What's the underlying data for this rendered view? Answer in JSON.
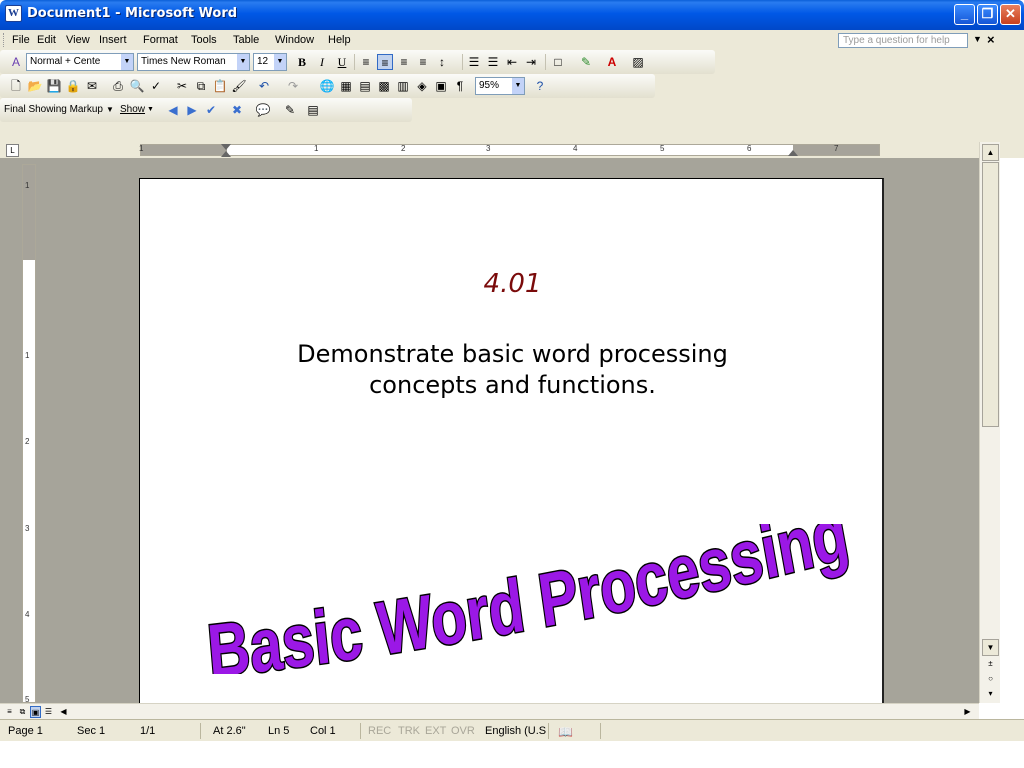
{
  "window": {
    "title": "Document1 - Microsoft Word",
    "icon": "word-app-icon"
  },
  "menu": {
    "items": [
      "File",
      "Edit",
      "View",
      "Insert",
      "Format",
      "Tools",
      "Table",
      "Window",
      "Help"
    ],
    "help_placeholder": "Type a question for help"
  },
  "formatting": {
    "style": "Normal + Cente",
    "font": "Times New Roman",
    "size": "12"
  },
  "standard": {
    "zoom": "95%"
  },
  "reviewing": {
    "markup_mode": "Final Showing Markup",
    "show_label": "Show"
  },
  "document": {
    "code": "4.01",
    "objective_line1": "Demonstrate basic word processing",
    "objective_line2": "concepts and functions.",
    "wordart": "Basic Word Processing",
    "wordart_colors": {
      "fill": "#9b18e6",
      "outline": "#000000"
    }
  },
  "status": {
    "page": "Page 1",
    "sec": "Sec 1",
    "pages": "1/1",
    "at": "At 2.6\"",
    "ln": "Ln 5",
    "col": "Col 1",
    "rec": "REC",
    "trk": "TRK",
    "ext": "EXT",
    "ovr": "OVR",
    "language": "English (U.S"
  },
  "ruler": {
    "h_numbers": [
      "1",
      "1",
      "2",
      "3",
      "4",
      "5",
      "6",
      "7"
    ],
    "v_numbers": [
      "1",
      "1",
      "2",
      "3",
      "4",
      "5"
    ]
  }
}
